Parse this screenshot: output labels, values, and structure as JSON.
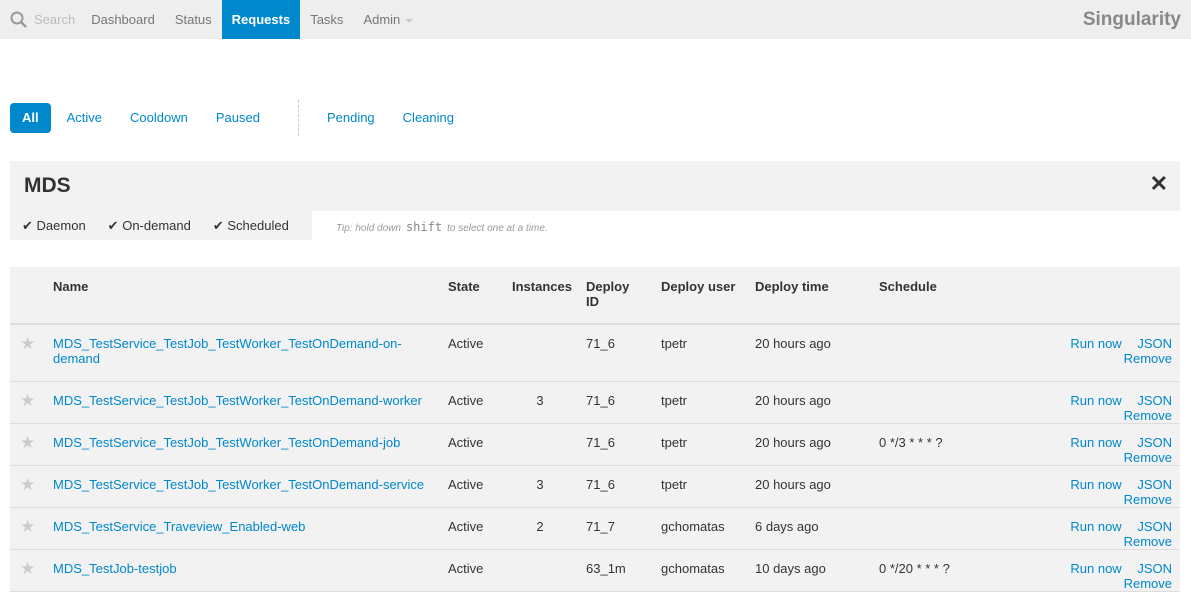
{
  "nav": {
    "search_placeholder": "Search",
    "items": [
      "Dashboard",
      "Status",
      "Requests",
      "Tasks",
      "Admin"
    ],
    "active": "Requests",
    "brand": "Singularity"
  },
  "filters": {
    "state": [
      "All",
      "Active",
      "Cooldown",
      "Paused"
    ],
    "other": [
      "Pending",
      "Cleaning"
    ],
    "active": "All"
  },
  "group": {
    "title": "MDS",
    "types": [
      "Daemon",
      "On-demand",
      "Scheduled"
    ],
    "tip_prefix": "Tip: hold down",
    "tip_key": "shift",
    "tip_suffix": "to select one at a time."
  },
  "table": {
    "headers": [
      "Name",
      "State",
      "Instances",
      "Deploy ID",
      "Deploy user",
      "Deploy time",
      "Schedule"
    ],
    "actions": [
      "Run now",
      "JSON",
      "Remove"
    ],
    "rows": [
      {
        "name": "MDS_TestService_TestJob_TestWorker_TestOnDemand-on-demand",
        "state": "Active",
        "instances": "",
        "deploy_id": "71_6",
        "user": "tpetr",
        "time": "20 hours ago",
        "schedule": ""
      },
      {
        "name": "MDS_TestService_TestJob_TestWorker_TestOnDemand-worker",
        "state": "Active",
        "instances": "3",
        "deploy_id": "71_6",
        "user": "tpetr",
        "time": "20 hours ago",
        "schedule": ""
      },
      {
        "name": "MDS_TestService_TestJob_TestWorker_TestOnDemand-job",
        "state": "Active",
        "instances": "",
        "deploy_id": "71_6",
        "user": "tpetr",
        "time": "20 hours ago",
        "schedule": "0 */3 * * * ?"
      },
      {
        "name": "MDS_TestService_TestJob_TestWorker_TestOnDemand-service",
        "state": "Active",
        "instances": "3",
        "deploy_id": "71_6",
        "user": "tpetr",
        "time": "20 hours ago",
        "schedule": ""
      },
      {
        "name": "MDS_TestService_Traveview_Enabled-web",
        "state": "Active",
        "instances": "2",
        "deploy_id": "71_7",
        "user": "gchomatas",
        "time": "6 days ago",
        "schedule": ""
      },
      {
        "name": "MDS_TestJob-testjob",
        "state": "Active",
        "instances": "",
        "deploy_id": "63_1m",
        "user": "gchomatas",
        "time": "10 days ago",
        "schedule": "0 */20 * * * ?"
      }
    ]
  }
}
